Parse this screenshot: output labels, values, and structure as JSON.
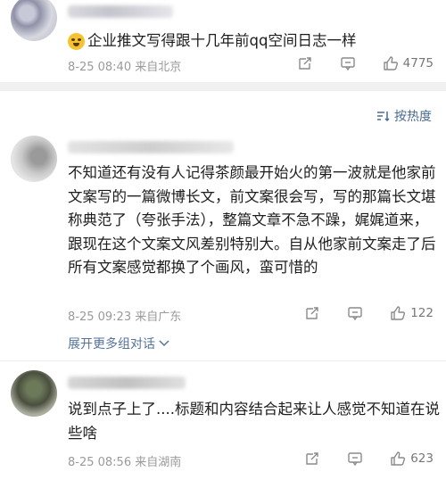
{
  "comments": [
    {
      "text": "企业推文写得跟十几年前qq空间日志一样",
      "emoji": "sad-face-emoji",
      "date": "8-25 08:40",
      "location": "来自北京",
      "likes": "4775"
    },
    {
      "text": "不知道还有没有人记得茶颜最开始火的第一波就是他家前文案写的一篇微博长文，前文案很会写，写的那篇长文堪称典范了（夸张手法），整篇文章不急不躁，娓娓道来，跟现在这个文案文风差别特别大。自从他家前文案走了后所有文案感觉都换了个画风，蛮可惜的",
      "date": "8-25 09:23",
      "location": "来自广东",
      "likes": "122"
    },
    {
      "text": "说到点子上了....标题和内容结合起来让人感觉不知道在说些啥",
      "date": "8-25 08:56",
      "location": "来自湖南",
      "likes": "623"
    }
  ],
  "sort": {
    "label": "按热度"
  },
  "expand": {
    "label": "展开更多组对话"
  },
  "colors": {
    "link": "#56739a",
    "meta": "#9a9a9a",
    "band": "#f0f0f0"
  },
  "icons": [
    "share-icon",
    "comment-icon",
    "like-icon",
    "sort-icon",
    "chevron-down-icon"
  ]
}
